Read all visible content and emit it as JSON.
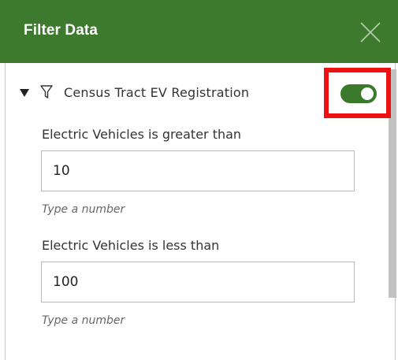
{
  "header": {
    "title": "Filter Data",
    "background_color": "#3d7a2e",
    "close_icon": "close-icon"
  },
  "layer": {
    "title": "Census Tract EV Registration",
    "expand_icon": "triangle-down-icon",
    "filter_icon": "filter-icon",
    "toggle_on": true,
    "toggle_color": "#3b7a2c",
    "highlight_color": "#ee1111"
  },
  "filters": [
    {
      "label": "Electric Vehicles is greater than",
      "value": "10",
      "hint": "Type a number"
    },
    {
      "label": "Electric Vehicles is less than",
      "value": "100",
      "hint": "Type a number"
    }
  ]
}
